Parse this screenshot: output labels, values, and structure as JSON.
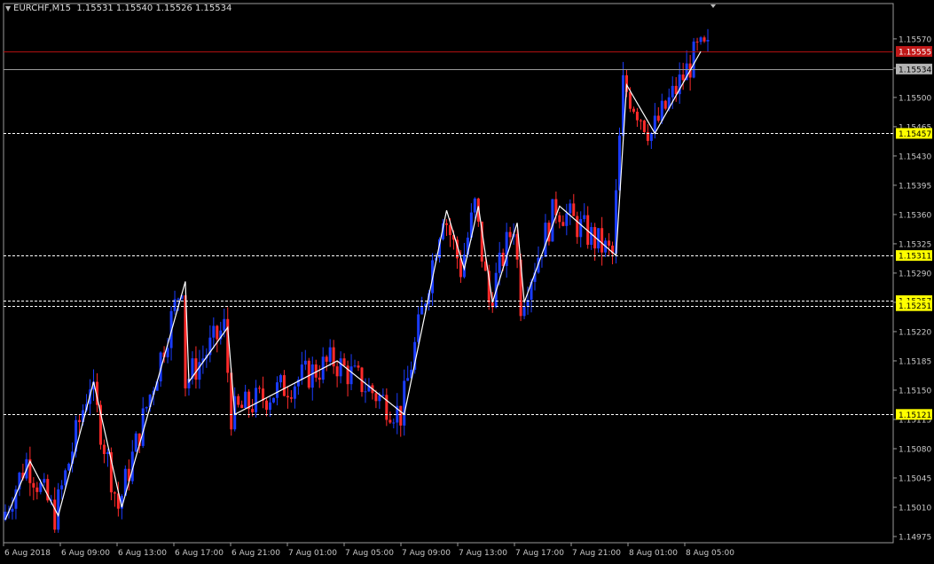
{
  "header": {
    "symbol": "EURCHF,M15",
    "ohlc": "1.15531 1.15540 1.15526 1.15534"
  },
  "colors": {
    "background": "#000000",
    "bull_candle": "#1a3cff",
    "bear_candle": "#ff2a2a",
    "zigzag": "#ffffff",
    "level_line": "#ffffff",
    "level_label_bg": "#ffff00",
    "ask_line": "#b01010",
    "ask_label_bg": "#c01818",
    "bid_line": "#9a9a9a",
    "bid_label_bg": "#b4b4b4",
    "axis_text": "#c8c8c8"
  },
  "chart_data": {
    "type": "candlestick",
    "symbol": "EURCHF",
    "timeframe": "M15",
    "ylim": [
      1.14975,
      1.1559
    ],
    "y_ticks": [
      "1.15570",
      "1.15535",
      "1.15500",
      "1.15465",
      "1.15430",
      "1.15395",
      "1.15360",
      "1.15325",
      "1.15290",
      "1.15255",
      "1.15220",
      "1.15185",
      "1.15150",
      "1.15115",
      "1.15080",
      "1.15045",
      "1.15010",
      "1.14975"
    ],
    "x_ticks": [
      "6 Aug 2018",
      "6 Aug 09:00",
      "6 Aug 13:00",
      "6 Aug 17:00",
      "6 Aug 21:00",
      "7 Aug 01:00",
      "7 Aug 05:00",
      "7 Aug 09:00",
      "7 Aug 13:00",
      "7 Aug 17:00",
      "7 Aug 21:00",
      "8 Aug 01:00",
      "8 Aug 05:00"
    ],
    "horizontal_levels": [
      {
        "value": 1.15457,
        "label": "1.15457"
      },
      {
        "value": 1.15311,
        "label": "1.15311"
      },
      {
        "value": 1.15257,
        "label": "1.15257"
      },
      {
        "value": 1.15251,
        "label": "1.15251"
      },
      {
        "value": 1.15121,
        "label": "1.15121"
      }
    ],
    "ask_price": {
      "value": 1.15555,
      "label": "1.15555"
    },
    "bid_price": {
      "value": 1.15534,
      "label": "1.15534"
    },
    "zigzag": [
      {
        "bar": 0,
        "price": 1.14995
      },
      {
        "bar": 7,
        "price": 1.15065
      },
      {
        "bar": 15,
        "price": 1.15
      },
      {
        "bar": 25,
        "price": 1.1516
      },
      {
        "bar": 33,
        "price": 1.1501
      },
      {
        "bar": 51,
        "price": 1.1528
      },
      {
        "bar": 52,
        "price": 1.1516
      },
      {
        "bar": 63,
        "price": 1.15225
      },
      {
        "bar": 65,
        "price": 1.15121
      },
      {
        "bar": 94,
        "price": 1.15185
      },
      {
        "bar": 113,
        "price": 1.15121
      },
      {
        "bar": 125,
        "price": 1.15365
      },
      {
        "bar": 130,
        "price": 1.15295
      },
      {
        "bar": 134,
        "price": 1.1537
      },
      {
        "bar": 138,
        "price": 1.15255
      },
      {
        "bar": 145,
        "price": 1.1535
      },
      {
        "bar": 147,
        "price": 1.15255
      },
      {
        "bar": 157,
        "price": 1.1537
      },
      {
        "bar": 173,
        "price": 1.15311
      },
      {
        "bar": 176,
        "price": 1.15515
      },
      {
        "bar": 184,
        "price": 1.15457
      },
      {
        "bar": 197,
        "price": 1.15555
      }
    ],
    "last_bar": 199
  }
}
